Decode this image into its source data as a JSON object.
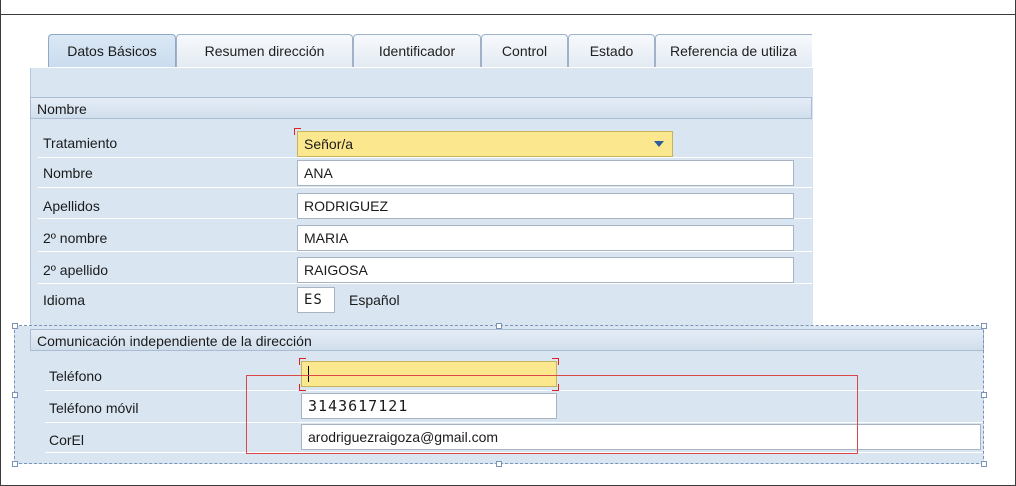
{
  "tabs": [
    {
      "label": "Datos Básicos",
      "active": true
    },
    {
      "label": "Resumen dirección",
      "active": false
    },
    {
      "label": "Identificador",
      "active": false
    },
    {
      "label": "Control",
      "active": false
    },
    {
      "label": "Estado",
      "active": false
    },
    {
      "label": "Referencia de utiliza",
      "active": false
    }
  ],
  "nombre_section": {
    "title": "Nombre",
    "tratamiento": {
      "label": "Tratamiento",
      "value": "Señor/a"
    },
    "nombre": {
      "label": "Nombre",
      "value": "ANA"
    },
    "apellidos": {
      "label": "Apellidos",
      "value": "RODRIGUEZ"
    },
    "segundo_nombre": {
      "label": "2º nombre",
      "value": "MARIA"
    },
    "segundo_apellido": {
      "label": "2º apellido",
      "value": "RAIGOSA"
    },
    "idioma": {
      "label": "Idioma",
      "code": "ES",
      "name": "Español"
    }
  },
  "comunicacion_section": {
    "title": "Comunicación independiente de la dirección",
    "telefono": {
      "label": "Teléfono",
      "value": ""
    },
    "telefono_movil": {
      "label": "Teléfono móvil",
      "value": "3143617121"
    },
    "correo": {
      "label": "CorEl",
      "value": "arodriguezraigoza@gmail.com"
    }
  },
  "colors": {
    "panel": "#d9e5f1",
    "required_field": "#fbe78e",
    "highlight_box": "#d94848"
  },
  "icons": [
    "dropdown-arrow-icon"
  ]
}
